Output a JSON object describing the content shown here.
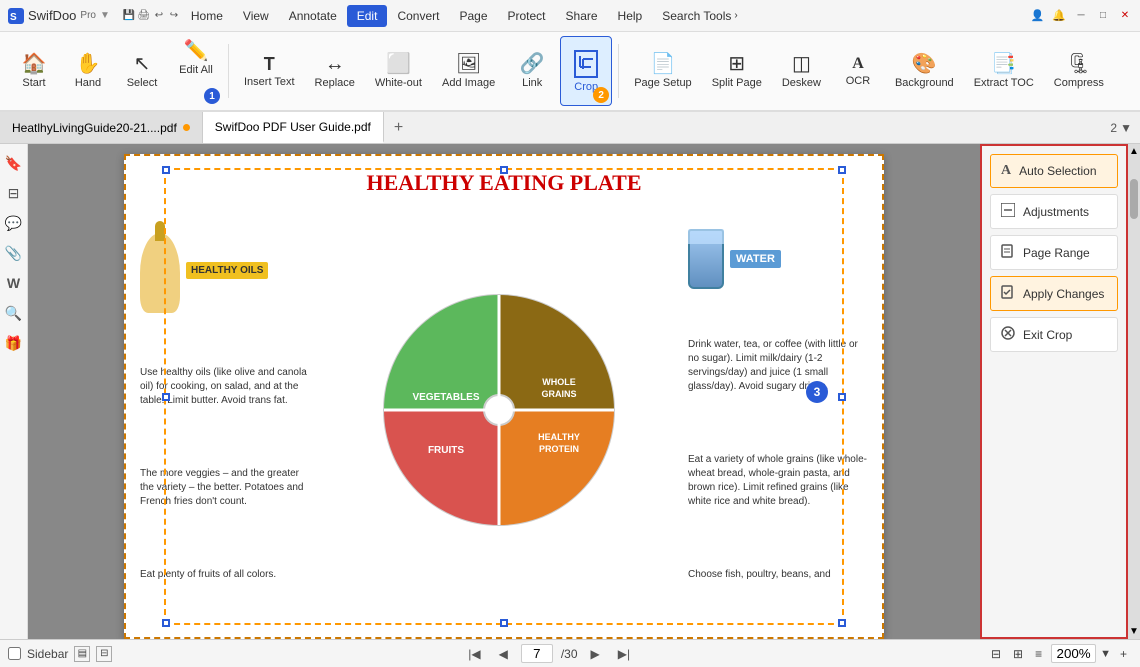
{
  "app": {
    "title": "SwifDoo-Pro",
    "logo": "SwifDoo",
    "pro": "Pro"
  },
  "title_bar": {
    "menus": [
      "Home",
      "View",
      "Annotate",
      "Edit",
      "Convert",
      "Page",
      "Protect",
      "Share",
      "Help",
      "Search Tools"
    ],
    "active_menu": "Edit"
  },
  "toolbar": {
    "buttons": [
      {
        "id": "start",
        "label": "Start",
        "icon": "🏠"
      },
      {
        "id": "hand",
        "label": "Hand",
        "icon": "✋"
      },
      {
        "id": "select",
        "label": "Select",
        "icon": "↖"
      },
      {
        "id": "edit-all",
        "label": "Edit All",
        "icon": "✏️"
      },
      {
        "id": "insert-text",
        "label": "Insert Text",
        "icon": "T"
      },
      {
        "id": "replace",
        "label": "Replace",
        "icon": "↔"
      },
      {
        "id": "white-out",
        "label": "White-out",
        "icon": "⬜"
      },
      {
        "id": "add-image",
        "label": "Add Image",
        "icon": "🖼"
      },
      {
        "id": "link",
        "label": "Link",
        "icon": "🔗"
      },
      {
        "id": "crop",
        "label": "Crop",
        "icon": "⊡"
      },
      {
        "id": "page-setup",
        "label": "Page Setup",
        "icon": "📄"
      },
      {
        "id": "split-page",
        "label": "Split Page",
        "icon": "⊞"
      },
      {
        "id": "deskew",
        "label": "Deskew",
        "icon": "◫"
      },
      {
        "id": "ocr",
        "label": "OCR",
        "icon": "A"
      },
      {
        "id": "background",
        "label": "Background",
        "icon": "🎨"
      },
      {
        "id": "extract-toc",
        "label": "Extract TOC",
        "icon": "📑"
      },
      {
        "id": "compress",
        "label": "Compress",
        "icon": "🗜"
      }
    ],
    "active": "crop",
    "step1_on": "add-image"
  },
  "tabs": [
    {
      "id": "tab1",
      "label": "HeatlhyLivingGuide20-21....pdf",
      "active": false,
      "dot": true
    },
    {
      "id": "tab2",
      "label": "SwifDoo PDF User Guide.pdf",
      "active": true,
      "dot": false
    }
  ],
  "left_sidebar": {
    "icons": [
      "bookmark",
      "layers",
      "comment",
      "attachment",
      "font",
      "search",
      "gift"
    ]
  },
  "infographic": {
    "title": "HEALTHY EATING PLATE",
    "left_texts": [
      "Use healthy oils (like olive and canola oil) for cooking, on salad, and at the table. Limit butter. Avoid trans fat.",
      "The more veggies – and the greater the variety – the better. Potatoes and French fries don't count.",
      "Eat plenty of fruits of all colors."
    ],
    "right_texts": [
      "Drink water, tea, or coffee (with little or no sugar). Limit milk/dairy (1-2 servings/day) and juice (1 small glass/day). Avoid sugary drinks.",
      "Eat a variety of whole grains (like whole-wheat bread, whole-grain pasta, and brown rice). Limit refined grains (like white rice and white bread).",
      "Choose fish, poultry, beans, and"
    ],
    "plate_sections": [
      {
        "label": "HEALTHY OILS",
        "color": "#f5c518"
      },
      {
        "label": "VEGETABLES",
        "color": "#5cb85c"
      },
      {
        "label": "FRUITS",
        "color": "#d9534f"
      },
      {
        "label": "WHOLE GRAINS",
        "color": "#8b6914"
      },
      {
        "label": "HEALTHY PROTEIN",
        "color": "#e67e22"
      }
    ],
    "water_label": "WATER"
  },
  "right_panel": {
    "buttons": [
      {
        "id": "auto-selection",
        "label": "Auto Selection",
        "icon": "A",
        "active": true
      },
      {
        "id": "adjustments",
        "label": "Adjustments",
        "icon": "⊞"
      },
      {
        "id": "page-range",
        "label": "Page Range",
        "icon": "📄"
      },
      {
        "id": "apply-changes",
        "label": "Apply Changes",
        "icon": "✔",
        "highlighted": true
      },
      {
        "id": "exit-crop",
        "label": "Exit Crop",
        "icon": "✕"
      }
    ]
  },
  "bottom_bar": {
    "sidebar_label": "Sidebar",
    "page_current": "7",
    "page_total": "/30",
    "zoom": "200%"
  },
  "step_labels": {
    "step1": "1",
    "step2": "2",
    "step3": "3"
  }
}
